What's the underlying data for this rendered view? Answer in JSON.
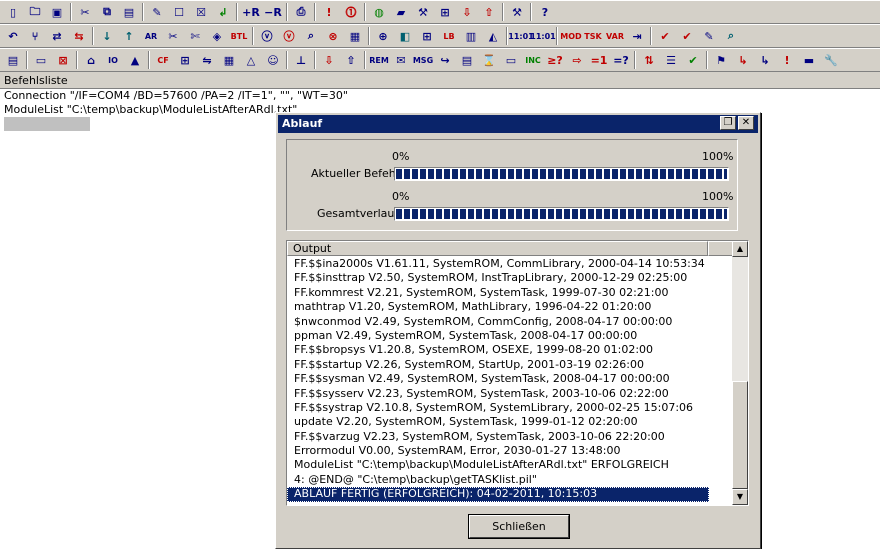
{
  "toolbar1": [
    {
      "name": "new-file-icon",
      "glyph": "▯"
    },
    {
      "name": "open-folder-icon",
      "glyph": "🗀"
    },
    {
      "name": "save-icon",
      "glyph": "▣"
    },
    {
      "sep": true
    },
    {
      "name": "cut-icon",
      "glyph": "✂"
    },
    {
      "name": "copy-icon",
      "glyph": "⧉"
    },
    {
      "name": "paste-icon",
      "glyph": "▤"
    },
    {
      "sep": true
    },
    {
      "name": "edit-icon",
      "glyph": "✎"
    },
    {
      "name": "uncheck-icon",
      "glyph": "☐"
    },
    {
      "name": "delete-box-icon",
      "glyph": "☒"
    },
    {
      "name": "enter-icon",
      "glyph": "↲",
      "cls": "green"
    },
    {
      "sep": true
    },
    {
      "name": "add-r-icon",
      "glyph": "+R"
    },
    {
      "name": "remove-r-icon",
      "glyph": "−R"
    },
    {
      "sep": true
    },
    {
      "name": "print-icon",
      "glyph": "⎙"
    },
    {
      "sep": true
    },
    {
      "name": "exclamation-icon",
      "glyph": "!",
      "cls": "red"
    },
    {
      "name": "exclamation-circle-icon",
      "glyph": "⓵",
      "cls": "red"
    },
    {
      "sep": true
    },
    {
      "name": "globe-icon",
      "glyph": "◍",
      "cls": "green"
    },
    {
      "name": "ruler-icon",
      "glyph": "▰"
    },
    {
      "name": "tools-icon",
      "glyph": "⚒"
    },
    {
      "name": "network-icon",
      "glyph": "⊞"
    },
    {
      "name": "download-icon",
      "glyph": "⇩",
      "cls": "red"
    },
    {
      "name": "upload-icon",
      "glyph": "⇧",
      "cls": "red"
    },
    {
      "sep": true
    },
    {
      "name": "hammer-icon",
      "glyph": "⚒"
    },
    {
      "sep": true
    },
    {
      "name": "help-icon",
      "glyph": "?"
    }
  ],
  "toolbar2": [
    {
      "name": "undo-icon",
      "glyph": "↶"
    },
    {
      "name": "branch-icon",
      "glyph": "⑂"
    },
    {
      "name": "flow-icon",
      "glyph": "⇄"
    },
    {
      "name": "swap-icon",
      "glyph": "⇆",
      "cls": "red"
    },
    {
      "sep": true
    },
    {
      "name": "arrow-down-icon",
      "glyph": "↓",
      "cls": "teal"
    },
    {
      "name": "arrow-up-icon",
      "glyph": "↑",
      "cls": "teal"
    },
    {
      "name": "ar-icon",
      "glyph": "AR",
      "cls": "small"
    },
    {
      "name": "scissors-icon",
      "glyph": "✂"
    },
    {
      "name": "cut-special-icon",
      "glyph": "✄"
    },
    {
      "name": "tag-icon",
      "glyph": "◈"
    },
    {
      "name": "btl-icon",
      "glyph": "BTL",
      "cls": "red small"
    },
    {
      "sep": true
    },
    {
      "name": "v-circle-icon",
      "glyph": "ⓥ"
    },
    {
      "name": "v-red-circle-icon",
      "glyph": "ⓥ",
      "cls": "red"
    },
    {
      "name": "magnifier-icon",
      "glyph": "⌕"
    },
    {
      "name": "stop-icon",
      "glyph": "⊗",
      "cls": "red"
    },
    {
      "name": "chip-icon",
      "glyph": "▦"
    },
    {
      "sep": true
    },
    {
      "name": "module-icon",
      "glyph": "⊕"
    },
    {
      "name": "cube-icon",
      "glyph": "◧",
      "cls": "teal"
    },
    {
      "name": "graph-icon",
      "glyph": "⊞"
    },
    {
      "name": "lb-icon",
      "glyph": "LB",
      "cls": "red small"
    },
    {
      "name": "book-icon",
      "glyph": "▥"
    },
    {
      "name": "eraser-icon",
      "glyph": "◭"
    },
    {
      "sep": true
    },
    {
      "name": "clock1-icon",
      "glyph": "11:01",
      "cls": "small"
    },
    {
      "name": "clock2-icon",
      "glyph": "11:01",
      "cls": "small"
    },
    {
      "sep": true
    },
    {
      "name": "mod-icon",
      "glyph": "MOD",
      "cls": "red small"
    },
    {
      "name": "tsk-icon",
      "glyph": "TSK",
      "cls": "red small"
    },
    {
      "name": "var-icon",
      "glyph": "VAR",
      "cls": "red small"
    },
    {
      "name": "export-icon",
      "glyph": "⇥"
    },
    {
      "sep": true
    },
    {
      "name": "check-red-icon",
      "glyph": "✔",
      "cls": "red"
    },
    {
      "name": "check-red2-icon",
      "glyph": "✔",
      "cls": "red"
    },
    {
      "name": "pencil-icon",
      "glyph": "✎"
    },
    {
      "name": "search-icon",
      "glyph": "⌕",
      "cls": "teal"
    }
  ],
  "toolbar3": [
    {
      "name": "clipboard-icon",
      "glyph": "▤"
    },
    {
      "sep": true
    },
    {
      "name": "window-icon",
      "glyph": "▭"
    },
    {
      "name": "x-window-icon",
      "glyph": "⊠",
      "cls": "red"
    },
    {
      "sep": true
    },
    {
      "name": "home-icon",
      "glyph": "⌂"
    },
    {
      "name": "io-icon",
      "glyph": "IO",
      "cls": "small"
    },
    {
      "name": "signal-icon",
      "glyph": "▲"
    },
    {
      "sep": true
    },
    {
      "name": "cf-icon",
      "glyph": "CF",
      "cls": "red small"
    },
    {
      "name": "tree-icon",
      "glyph": "⊞"
    },
    {
      "name": "connect-icon",
      "glyph": "⇋"
    },
    {
      "name": "layout-icon",
      "glyph": "▦"
    },
    {
      "name": "warn-icon",
      "glyph": "△"
    },
    {
      "name": "smile-icon",
      "glyph": "☺"
    },
    {
      "sep": true
    },
    {
      "name": "org-icon",
      "glyph": "⊥"
    },
    {
      "sep": true
    },
    {
      "name": "import-icon",
      "glyph": "⇩",
      "cls": "red"
    },
    {
      "name": "export2-icon",
      "glyph": "⇧"
    },
    {
      "sep": true
    },
    {
      "name": "rem-icon",
      "glyph": "REM",
      "cls": "small"
    },
    {
      "name": "mail-icon",
      "glyph": "✉"
    },
    {
      "name": "msg-icon",
      "glyph": "MSG",
      "cls": "small"
    },
    {
      "name": "goto-icon",
      "glyph": "↪"
    },
    {
      "name": "form-icon",
      "glyph": "▤"
    },
    {
      "name": "hourglass-icon",
      "glyph": "⌛"
    },
    {
      "name": "window2-icon",
      "glyph": "▭"
    },
    {
      "name": "inc-icon",
      "glyph": "INC",
      "cls": "green small"
    },
    {
      "name": "pipe-icon",
      "glyph": "≥?",
      "cls": "red"
    },
    {
      "name": "arrow-right-icon",
      "glyph": "⇨",
      "cls": "red"
    },
    {
      "name": "assign-icon",
      "glyph": "=1",
      "cls": "red"
    },
    {
      "name": "compare-icon",
      "glyph": "=?"
    },
    {
      "sep": true
    },
    {
      "name": "sort-icon",
      "glyph": "⇅",
      "cls": "red"
    },
    {
      "name": "list-icon",
      "glyph": "☰"
    },
    {
      "name": "ok-icon",
      "glyph": "✔",
      "cls": "green"
    },
    {
      "sep": true
    },
    {
      "name": "flag-icon",
      "glyph": "⚑"
    },
    {
      "name": "jump-icon",
      "glyph": "↳",
      "cls": "red"
    },
    {
      "name": "jump2-icon",
      "glyph": "↳"
    },
    {
      "name": "warn2-icon",
      "glyph": "!",
      "cls": "red"
    },
    {
      "name": "terminal-icon",
      "glyph": "▬"
    },
    {
      "name": "wrench-icon",
      "glyph": "🔧"
    }
  ],
  "document": {
    "header": "Befehlsliste",
    "lines": [
      "Connection \"/IF=COM4 /BD=57600 /PA=2 /IT=1\", \"\", \"WT=30\"",
      "ModuleList \"C:\\temp\\backup\\ModuleListAfterARdl.txt\""
    ]
  },
  "dialog": {
    "title": "Ablauf",
    "restore_glyph": "❐",
    "close_glyph": "✕",
    "current_label": "Aktueller Befehl",
    "total_label": "Gesamtverlauf",
    "min_label": "0%",
    "max_label": "100%",
    "current_progress": 1.0,
    "total_progress": 1.0,
    "output_header": "Output",
    "output_lines": [
      "FF.$$ina2000s V1.61.11, SystemROM, CommLibrary, 2000-04-14 10:53:34",
      "FF.$$insttrap V2.50, SystemROM, InstTrapLibrary, 2000-12-29 02:25:00",
      "FF.kommrest V2.21, SystemROM, SystemTask, 1999-07-30 02:21:00",
      "mathtrap V1.20, SystemROM, MathLibrary, 1996-04-22 01:20:00",
      "$nwconmod V2.49, SystemROM, CommConfig, 2008-04-17 00:00:00",
      "ppman V2.49, SystemROM, SystemTask, 2008-04-17 00:00:00",
      "FF.$$bropsys V1.20.8, SystemROM, OSEXE, 1999-08-20 01:02:00",
      "FF.$$startup V2.26, SystemROM, StartUp, 2001-03-19 02:26:00",
      "FF.$$sysman V2.49, SystemROM, SystemTask, 2008-04-17 00:00:00",
      "FF.$$sysserv V2.23, SystemROM, SystemTask, 2003-10-06 02:22:00",
      "FF.$$systrap V2.10.8, SystemROM, SystemLibrary, 2000-02-25 15:07:06",
      "update V2.20, SystemROM, SystemTask, 1999-01-12 02:20:00",
      "FF.$$varzug V2.23, SystemROM, SystemTask, 2003-10-06 22:20:00",
      "Errormodul V0.00, SystemRAM, Error, 2030-01-27 13:48:00",
      "ModuleList \"C:\\temp\\backup\\ModuleListAfterARdl.txt\" ERFOLGREICH",
      "4: @END@ \"C:\\temp\\backup\\getTASKlist.pil\"",
      "ABLAUF FERTIG (ERFOLGREICH): 04-02-2011, 10:15:03"
    ],
    "selected_index": 16,
    "scroll_up_glyph": "▲",
    "scroll_down_glyph": "▼",
    "close_button": "Schließen"
  }
}
